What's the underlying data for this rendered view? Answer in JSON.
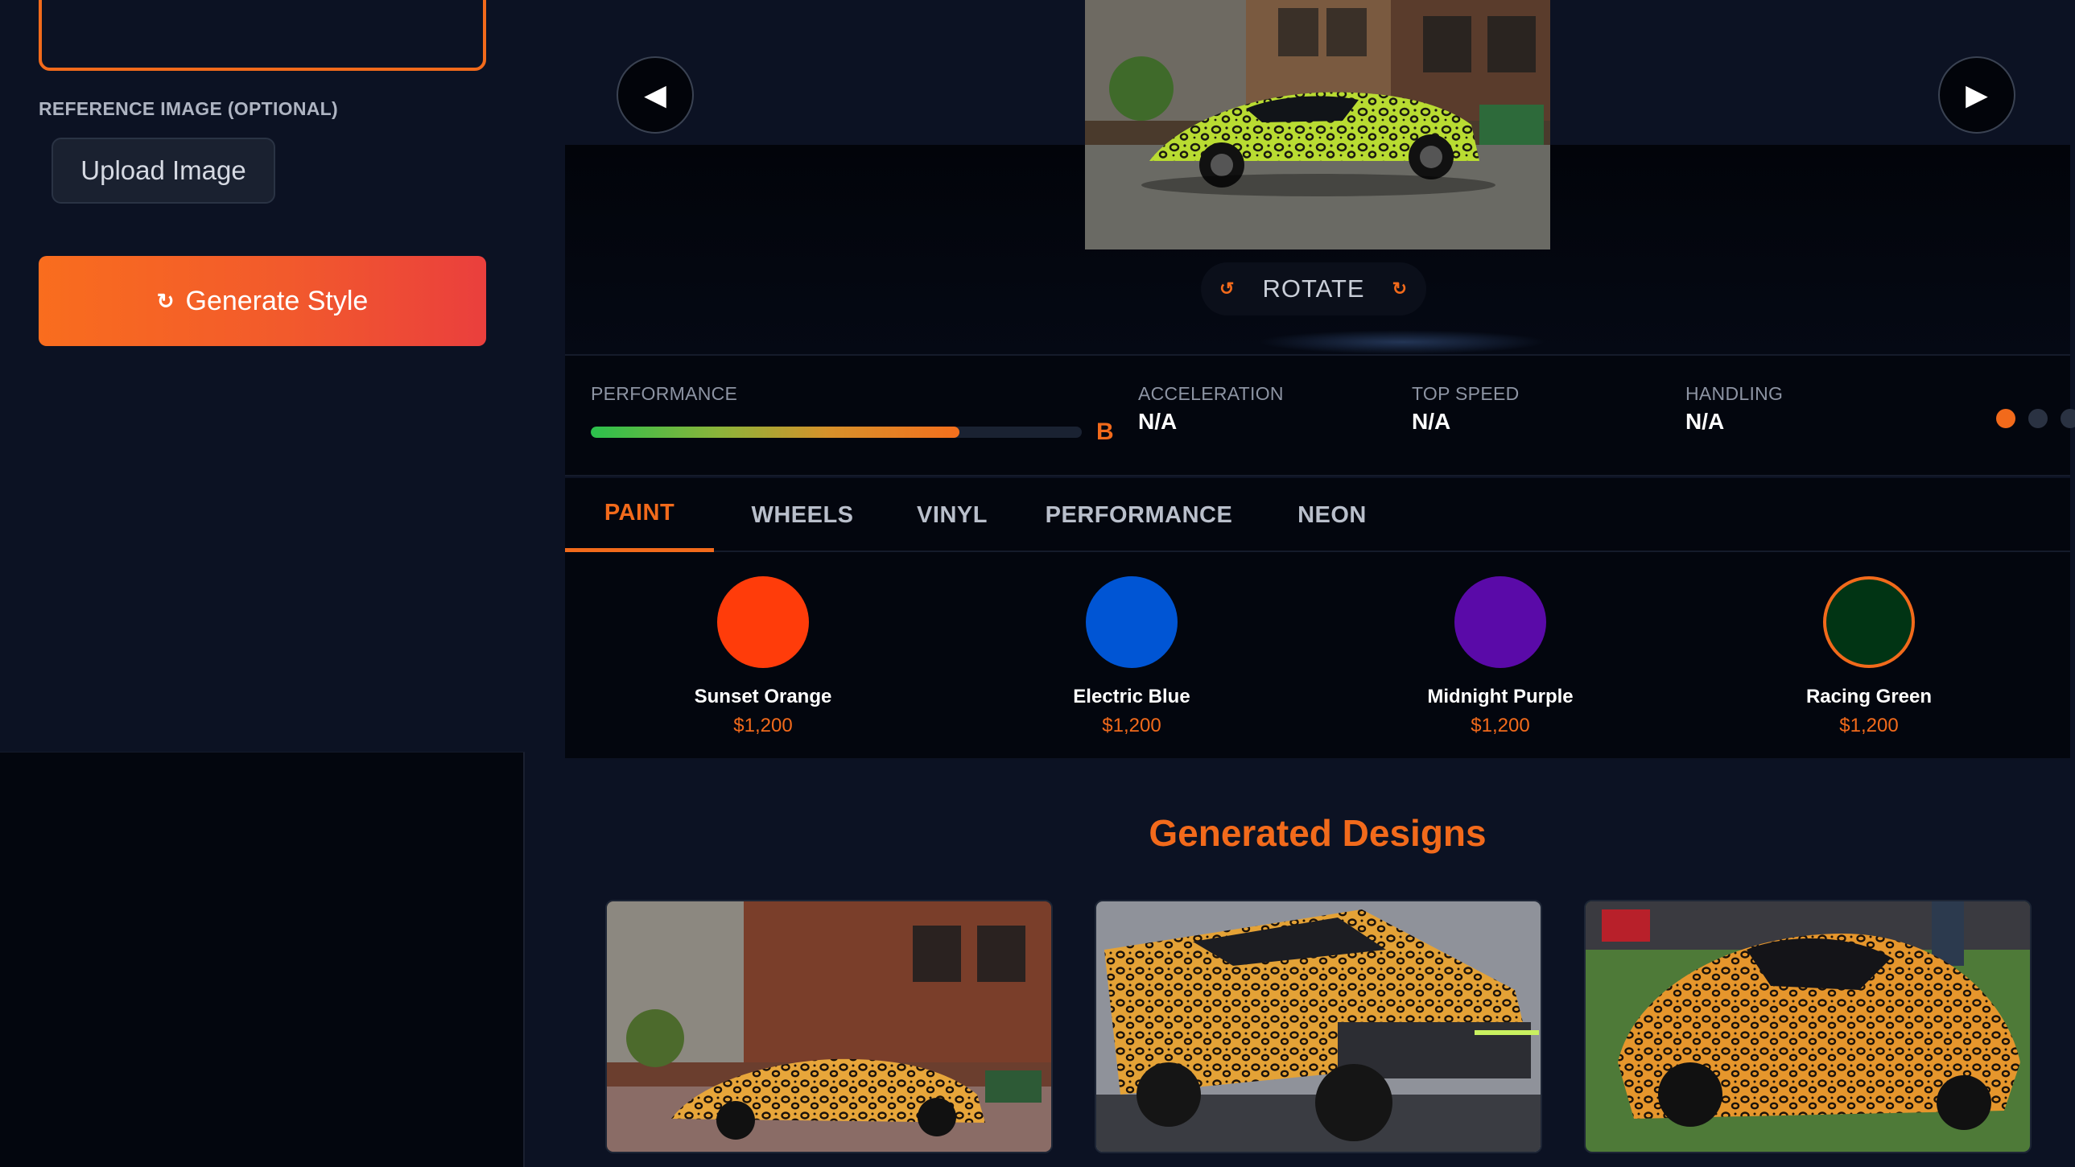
{
  "sidebar": {
    "reference_label": "REFERENCE IMAGE (OPTIONAL)",
    "upload_label": "Upload Image",
    "generate_label": "Generate Style",
    "generate_icon": "refresh-icon"
  },
  "viewer": {
    "prev_glyph": "◀",
    "next_glyph": "▶",
    "rotate_label": "ROTATE",
    "rotate_left_glyph": "↺",
    "rotate_right_glyph": "↻"
  },
  "stats": {
    "performance_label": "PERFORMANCE",
    "performance_level": 0.75,
    "performance_grade": "B",
    "acceleration_label": "ACCELERATION",
    "acceleration_value": "N/A",
    "top_speed_label": "TOP SPEED",
    "top_speed_value": "N/A",
    "handling_label": "HANDLING",
    "handling_value": "N/A"
  },
  "tabs": [
    "PAINT",
    "WHEELS",
    "VINYL",
    "PERFORMANCE",
    "NEON"
  ],
  "active_tab": "PAINT",
  "paints": [
    {
      "name": "Sunset Orange",
      "price": "$1,200",
      "color": "#ff3c0a"
    },
    {
      "name": "Electric Blue",
      "price": "$1,200",
      "color": "#0055d4"
    },
    {
      "name": "Midnight Purple",
      "price": "$1,200",
      "color": "#5a0aa8"
    },
    {
      "name": "Racing Green",
      "price": "$1,200",
      "color": "#013414"
    }
  ],
  "selected_paint": "Racing Green",
  "designs": {
    "title": "Generated Designs"
  },
  "colors": {
    "accent": "#f26a1b",
    "background": "#0c1223"
  }
}
